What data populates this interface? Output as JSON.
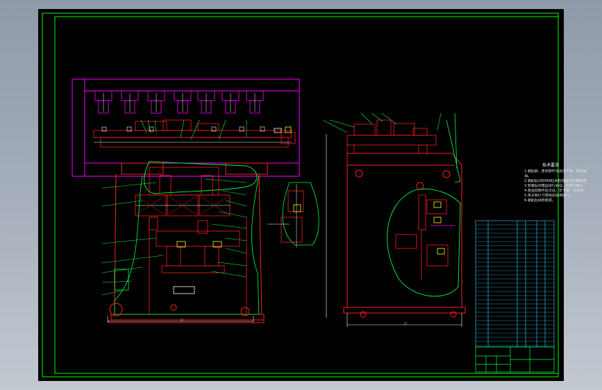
{
  "drawing": {
    "background": "#000000",
    "colors": {
      "border": "#00ff00",
      "outline": "#ff2020",
      "leader": "#00ff44",
      "magenta": "#ff00ff",
      "white": "#ffffff",
      "cyan": "#33ddff",
      "yellow": "#ffff00"
    },
    "sheet_frame": "double-line",
    "views": [
      "front-section-view",
      "side-view",
      "detail-view"
    ]
  },
  "notes": {
    "title": "技术要求",
    "lines": [
      "1.装配前，各零部件须清洗干净，所有运动件应注",
      "油。",
      "2.装配后1600kN压机应保证设计精度要求。",
      "3.安装后对模具进行调试，检查冲裁力，保证送料精度。",
      "4.各运动部件应灵活，无卡滞、无异响，润滑充分。",
      "5.未注明尺寸按相关标准执行。",
      "6.装配后涂防锈漆。"
    ]
  },
  "dimension_labels": {
    "front_width_mark": "□",
    "side_width_mark": "□"
  }
}
